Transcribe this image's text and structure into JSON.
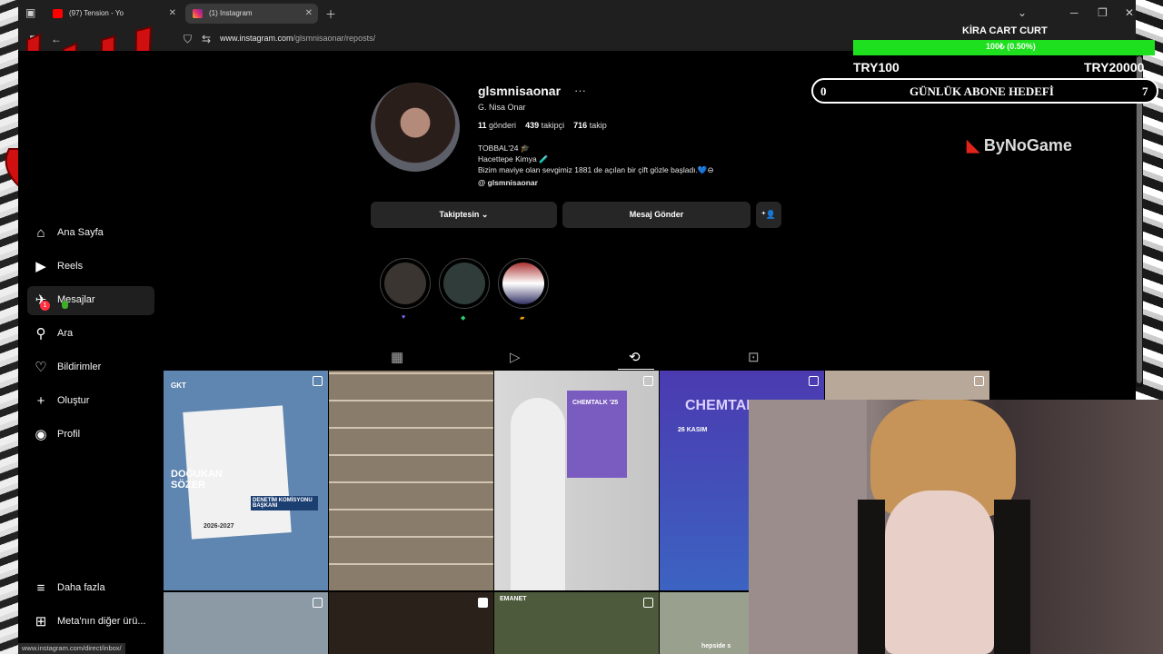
{
  "browser": {
    "tabs": [
      {
        "label": "(97) Tension - Yo",
        "icon": "youtube-icon",
        "color": "#ff0000"
      },
      {
        "label": "(1) Instagram",
        "icon": "instagram-icon",
        "color": "#e1306c"
      }
    ],
    "url_host": "www.instagram.com",
    "url_path": "/glsmnisaonar/reposts/",
    "status_url": "www.instagram.com/direct/inbox/"
  },
  "sidebar": {
    "items": [
      {
        "label": "Ana Sayfa",
        "icon": "home-icon"
      },
      {
        "label": "Reels",
        "icon": "reels-icon"
      },
      {
        "label": "Mesajlar",
        "icon": "messages-icon",
        "badge": "1"
      },
      {
        "label": "Ara",
        "icon": "search-icon"
      },
      {
        "label": "Bildirimler",
        "icon": "heart-icon"
      },
      {
        "label": "Oluştur",
        "icon": "plus-icon"
      },
      {
        "label": "Profil",
        "icon": "profile-icon"
      },
      {
        "label": "Daha fazla",
        "icon": "menu-icon"
      },
      {
        "label": "Meta'nın diğer ürü...",
        "icon": "grid-icon"
      }
    ]
  },
  "profile": {
    "username": "glsmnisaonar",
    "full_name": "G. Nisa Onar",
    "posts_count": "11",
    "posts_label": "gönderi",
    "followers_count": "439",
    "followers_label": "takipçi",
    "following_count": "716",
    "following_label": "takip",
    "bio_lines": [
      "TOBBAL'24 🎓",
      "Hacettepe Kimya 🧪",
      "Bizim maviye olan sevgimiz 1881 de açılan bir çift gözle başladı.💙⊖"
    ],
    "threads_handle": "glsmnisaonar",
    "following_button": "Takiptesin",
    "message_button": "Mesaj Gönder"
  },
  "posts": {
    "tile1_name": "DOĞUKAN SÖZER",
    "tile1_role": "DENETİM KOMİSYONU BAŞKANI",
    "tile1_years": "2026-2027",
    "tile1_brand": "GKT",
    "tile3_poster": "CHEMTALK '25",
    "tile4_title": "CHEMTALK",
    "tile4_date": "26 KASIM",
    "tile7_text": "EMANET",
    "tile8_text": "hepside s"
  },
  "overlay": {
    "sub_label": "KİRA CART CURT",
    "progress_text": "100₺ (0.50%)",
    "progress_fraction": 0.005,
    "min_label": "TRY100",
    "max_label": "TRY20000",
    "goal_left": "0",
    "goal_label": "GÜNLÜK ABONE HEDEFİ",
    "goal_right": "7",
    "brand": "ByNoGame"
  },
  "colors": {
    "accent_green": "#1fe01f",
    "notif_red": "#ff3040",
    "logo_red": "#d01010"
  }
}
